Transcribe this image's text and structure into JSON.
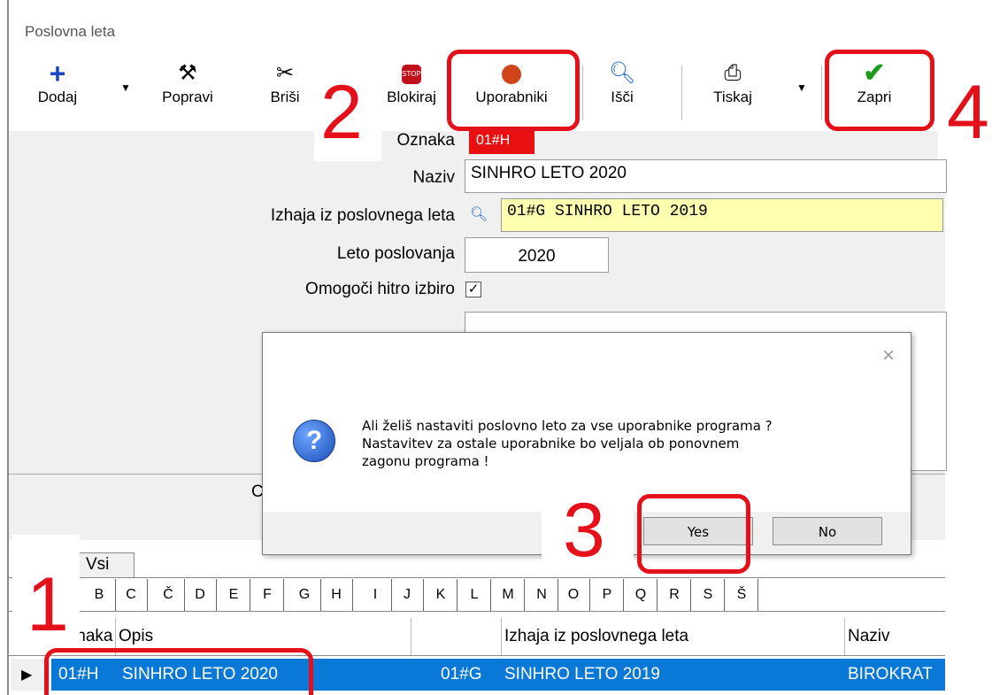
{
  "window": {
    "title": "Poslovna leta"
  },
  "toolbar": {
    "dodaj": "Dodaj",
    "popravi": "Popravi",
    "brisi": "Briši",
    "blokiraj": "Blokiraj",
    "uporabniki": "Uporabniki",
    "isci": "Išči",
    "tiskaj": "Tiskaj",
    "zapri": "Zapri"
  },
  "form": {
    "oznaka_label": "Oznaka",
    "oznaka_value": "01#H",
    "naziv_label": "Naziv",
    "naziv_value": "SINHRO LETO 2020",
    "izhaja_label": "Izhaja iz poslovnega leta",
    "izhaja_value": "01#G SINHRO LETO 2019",
    "leto_label": "Leto poslovanja",
    "leto_value": "2020",
    "hitro_label": "Omogoči hitro izbiro",
    "hitro_checked": "✓",
    "partial_label": "C"
  },
  "dialog": {
    "line1": "Ali želiš nastaviti poslovno leto za vse uporabnike programa ?",
    "line2": "Nastavitev za ostale uporabnike bo veljala ob ponovnem",
    "line3": "zagonu programa !",
    "yes": "Yes",
    "no": "No",
    "close": "×"
  },
  "tabs": {
    "vsi": "Vsi"
  },
  "letters": [
    "B",
    "C",
    "Č",
    "D",
    "E",
    "F",
    "G",
    "H",
    "I",
    "J",
    "K",
    "L",
    "M",
    "N",
    "O",
    "P",
    "Q",
    "R",
    "S",
    "Š"
  ],
  "grid": {
    "headers": {
      "oznaka": "Oznaka",
      "opis": "Opis",
      "izhaja": "Izhaja iz poslovnega leta",
      "naziv": "Naziv"
    },
    "row": {
      "oznaka": "01#H",
      "opis": "SINHRO LETO 2020",
      "izhaja_code": "01#G",
      "izhaja_name": "SINHRO LETO 2019",
      "naziv": "BIROKRAT"
    }
  },
  "annotations": {
    "n1": "1",
    "n2": "2",
    "n3": "3",
    "n4": "4"
  }
}
